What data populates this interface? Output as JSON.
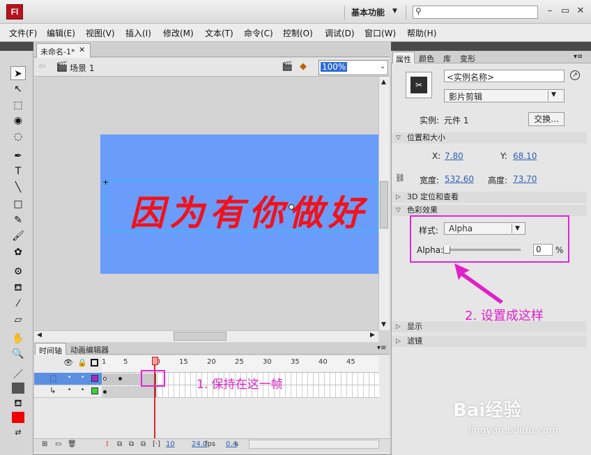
{
  "app": {
    "logo": "Fl",
    "workspace": "基本功能",
    "search_placeholder": ""
  },
  "menu": [
    "文件(F)",
    "编辑(E)",
    "视图(V)",
    "插入(I)",
    "修改(M)",
    "文本(T)",
    "命令(C)",
    "控制(O)",
    "调试(D)",
    "窗口(W)",
    "帮助(H)"
  ],
  "document": {
    "tab_title": "未命名-1*",
    "scene": "场景 1",
    "zoom": "100%",
    "stage_text": "因为有你做好"
  },
  "timeline": {
    "tabs": [
      "时间轴",
      "动画编辑器"
    ],
    "ruler": [
      "1",
      "5",
      "10",
      "15",
      "20",
      "25",
      "30",
      "35",
      "40",
      "45"
    ],
    "current_frame": "10",
    "fps": "24.0",
    "fps_unit": "fps",
    "time": "0.4",
    "time_unit": "s",
    "annotation": "1. 保持在这一帧"
  },
  "properties": {
    "tabs": [
      "属性",
      "颜色",
      "库",
      "变形"
    ],
    "instance_name_placeholder": "<实例名称>",
    "instance_type": "影片剪辑",
    "instance_of_label": "实例:",
    "instance_of_value": "元件 1",
    "swap_button": "交换...",
    "section_position": "位置和大小",
    "x_label": "X:",
    "x_value": "7.80",
    "y_label": "Y:",
    "y_value": "68.10",
    "width_label": "宽度:",
    "width_value": "532.60",
    "height_label": "高度:",
    "height_value": "73.70",
    "section_3d": "3D 定位和查看",
    "section_color": "色彩效果",
    "style_label": "样式:",
    "style_value": "Alpha",
    "alpha_label": "Alpha:",
    "alpha_value": "0",
    "alpha_unit": "%",
    "section_display": "显示",
    "section_filters": "滤镜",
    "annotation": "2. 设置成这样"
  },
  "watermark": {
    "brand": "Bai经验",
    "url": "jingyan.baidu.com"
  },
  "colors": {
    "stage": "#6a9cfb",
    "stage_text": "#f1121a",
    "annotation": "#e020c8",
    "fill_color": "#ee0000",
    "stroke_color": "#555555"
  }
}
